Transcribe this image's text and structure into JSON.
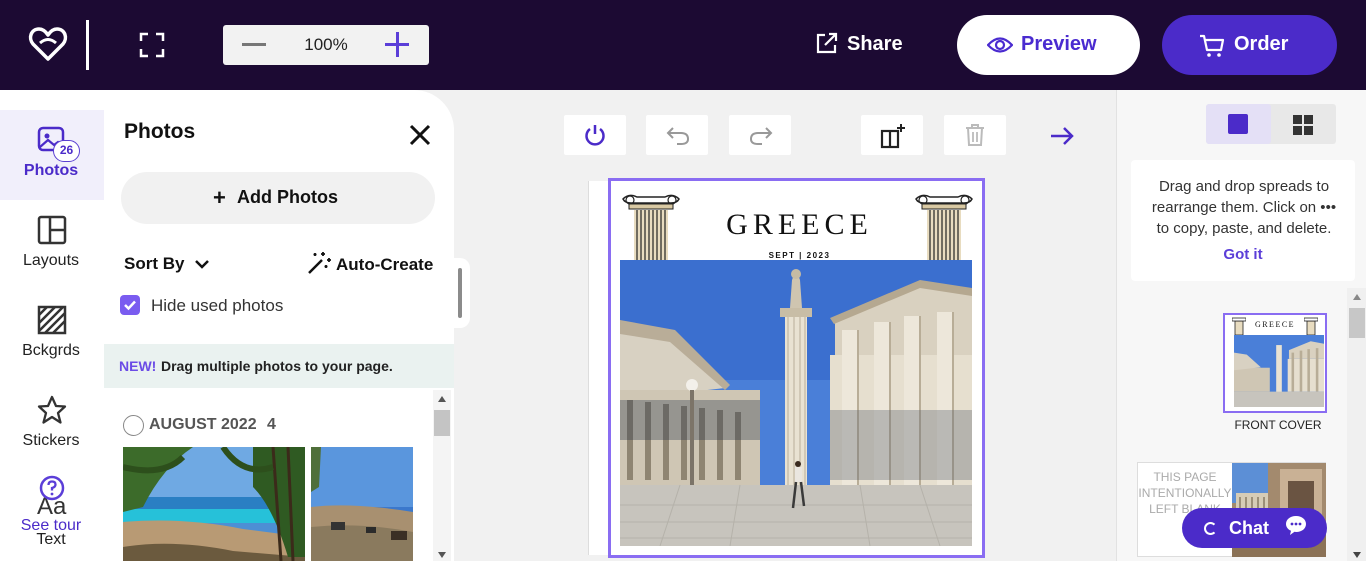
{
  "topbar": {
    "zoom_value": "100%",
    "share_label": "Share",
    "preview_label": "Preview",
    "order_label": "Order",
    "icons": [
      "heart-logo-icon",
      "fullscreen-icon",
      "zoom-out-icon",
      "zoom-in-icon",
      "share-icon",
      "eye-icon",
      "cart-icon"
    ]
  },
  "rail": {
    "items": [
      {
        "label": "Photos",
        "badge": "26",
        "icon": "photos-icon",
        "active": true
      },
      {
        "label": "Layouts",
        "icon": "layouts-icon"
      },
      {
        "label": "Bckgrds",
        "icon": "backgrounds-icon"
      },
      {
        "label": "Stickers",
        "icon": "star-icon"
      },
      {
        "label": "Text",
        "icon": "text-icon"
      }
    ],
    "see_tour": "See tour"
  },
  "panel": {
    "title": "Photos",
    "add_photos": "Add Photos",
    "sort_by": "Sort By",
    "auto_create": "Auto-Create",
    "hide_used": "Hide used photos",
    "hide_used_checked": true,
    "banner_new": "NEW!",
    "banner_msg": "Drag multiple photos to your page.",
    "album": {
      "name": "AUGUST 2022",
      "count": "4"
    }
  },
  "page": {
    "title": "GREECE",
    "subtitle": "SEPT | 2023"
  },
  "right_panel": {
    "tip_text": "Drag and drop spreads to rearrange them. Click on ••• to copy, paste, and delete.",
    "tip_dots": "•••",
    "got_it": "Got it",
    "cover_title": "GREECE",
    "cover_label": "FRONT COVER",
    "blank_page": "THIS PAGE INTENTIONALLY LEFT BLANK",
    "chat_label": "Chat"
  },
  "colors": {
    "topbar_bg": "#1c0a33",
    "brand_purple": "#4b2bc9",
    "selection_purple": "#8a6df2"
  }
}
